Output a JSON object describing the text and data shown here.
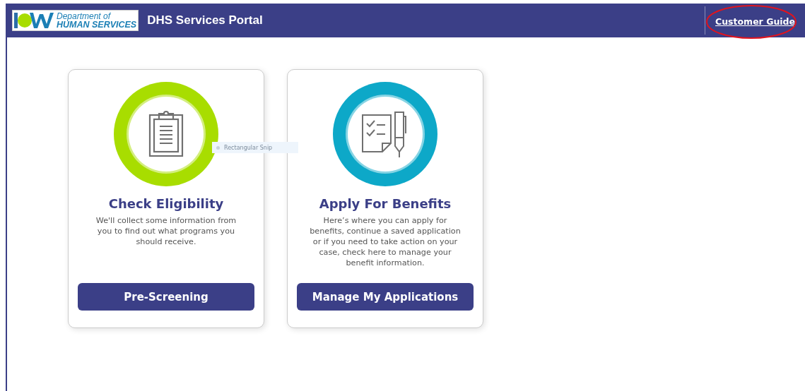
{
  "header": {
    "logo_line_1": "Department of",
    "logo_line_2": "HUMAN SERVICES",
    "title": "DHS Services Portal",
    "link": "Customer Guide",
    "link_circled": true
  },
  "cards": [
    {
      "kind": "clipboard",
      "color": "#a8dd00",
      "title": "Check Eligibility",
      "description": "We'll collect some information from you to find out what programs you should receive.",
      "button": "Pre-Screening"
    },
    {
      "kind": "form-pen",
      "color": "#0da8c8",
      "title": "Apply For Benefits",
      "description": "Here’s where you can apply for benefits, continue a saved application or if you need to take action on your case, check here to manage your benefit information.",
      "button": "Manage My Applications"
    }
  ],
  "snip_tooltip": "Rectangular Snip"
}
